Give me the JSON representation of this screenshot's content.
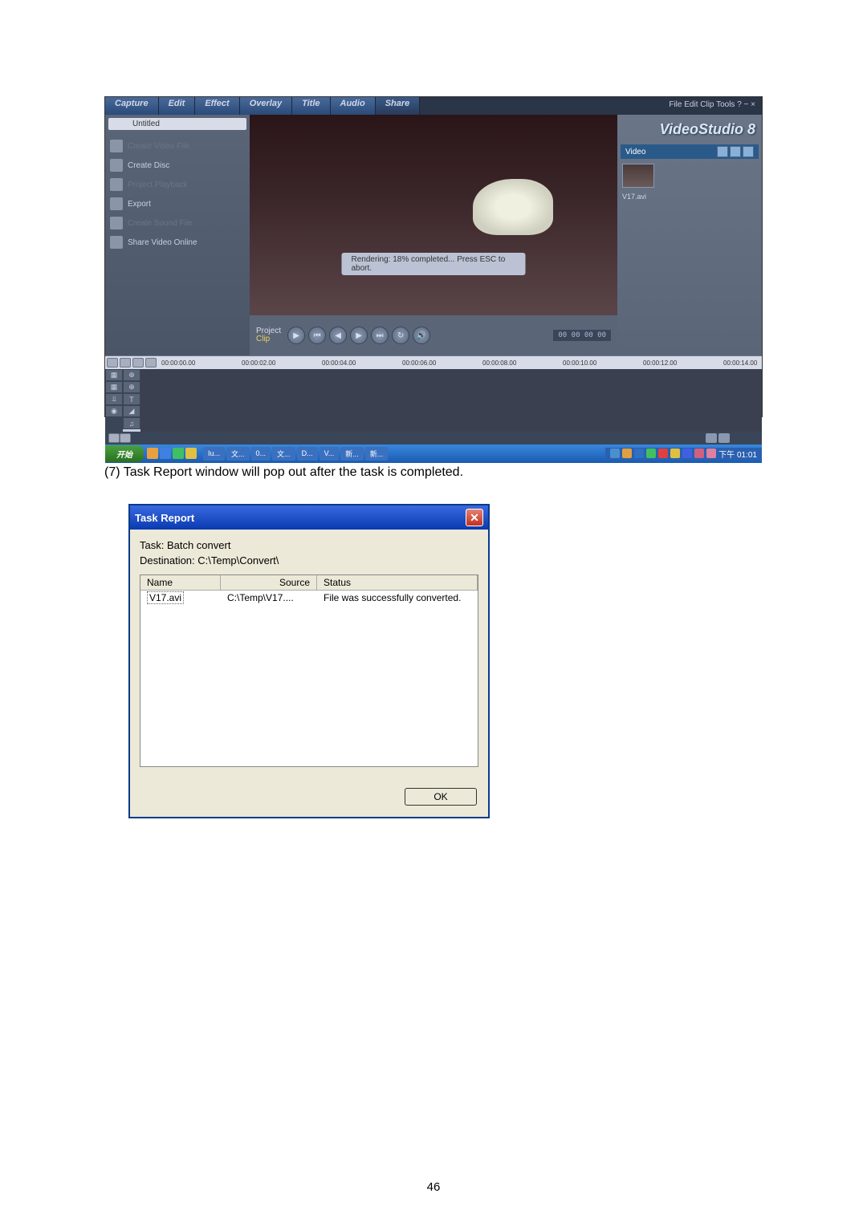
{
  "videostudio": {
    "tabs": [
      "Capture",
      "Edit",
      "Effect",
      "Overlay",
      "Title",
      "Audio",
      "Share"
    ],
    "menuRight": "File Edit Clip Tools ? − ×",
    "projectName": "Untitled",
    "shareItems": [
      {
        "label": "Create Video File",
        "disabled": true
      },
      {
        "label": "Create Disc",
        "disabled": false
      },
      {
        "label": "Project Playback",
        "disabled": true
      },
      {
        "label": "Export",
        "disabled": false
      },
      {
        "label": "Create Sound File",
        "disabled": true
      },
      {
        "label": "Share Video Online",
        "disabled": false
      }
    ],
    "renderingStatus": "Rendering: 18% completed... Press ESC to abort.",
    "projectLabel": "Project",
    "clipLabel": "Clip",
    "timecode": "00 00 00 00",
    "logo": "VideoStudio 8",
    "galleryCategory": "Video",
    "thumbnailLabel": "V17.avi",
    "timeMarks": [
      "00:00:00.00",
      "00:00:02.00",
      "00:00:04.00",
      "00:00:06.00",
      "00:00:08.00",
      "00:00:10.00",
      "00:00:12.00",
      "00:00:14.00"
    ],
    "trackLabels": [
      "⊕",
      "⊕",
      "T",
      "◢",
      "♫"
    ]
  },
  "taskbar": {
    "start": "开始",
    "items": [
      "Iu...",
      "文...",
      "0...",
      "文...",
      "D...",
      "V...",
      "新...",
      "新..."
    ],
    "clock": "下午 01:01"
  },
  "paragraph": "(7) Task Report window will pop out after the task is completed.",
  "taskReport": {
    "title": "Task Report",
    "task": "Task: Batch convert",
    "destination": "Destination: C:\\Temp\\Convert\\",
    "headers": {
      "name": "Name",
      "source": "Source",
      "status": "Status"
    },
    "row": {
      "name": "V17.avi",
      "source": "C:\\Temp\\V17....",
      "status": "File was successfully converted."
    },
    "okButton": "OK"
  },
  "pageNumber": "46"
}
